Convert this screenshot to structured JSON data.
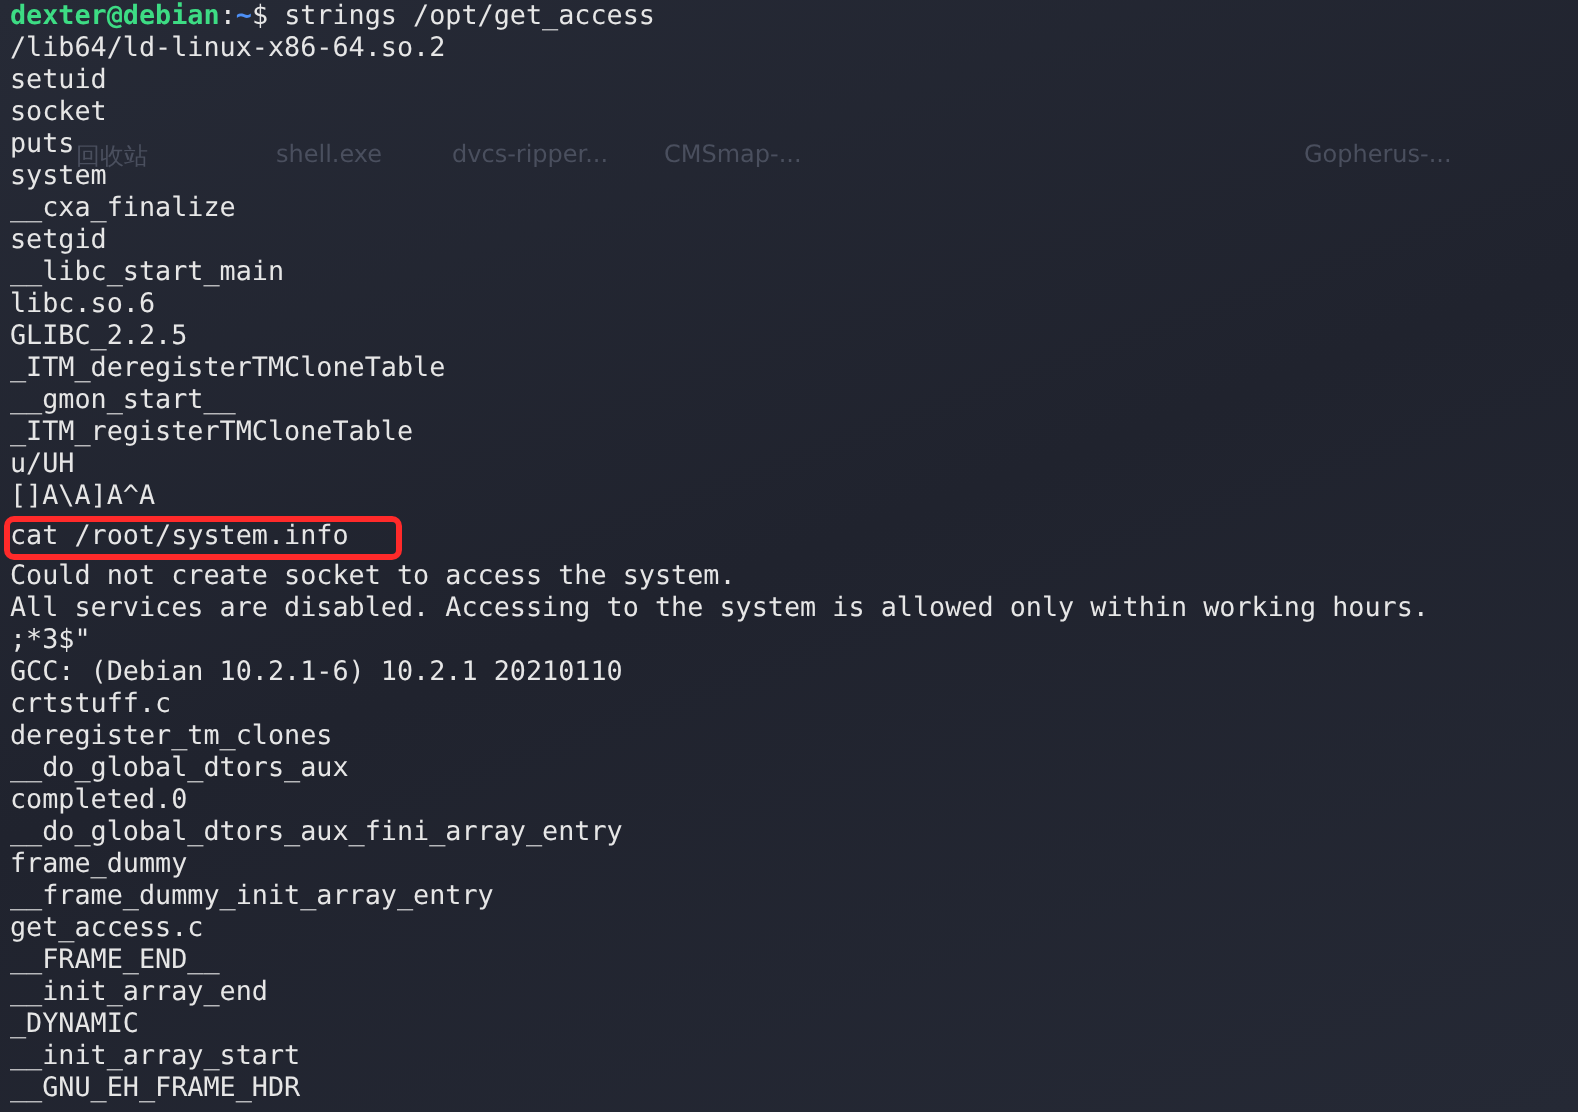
{
  "desktop_icons": [
    {
      "label": "回收站"
    },
    {
      "label": "shell.exe"
    },
    {
      "label": "dvcs-ripper..."
    },
    {
      "label": "CMSmap-..."
    },
    {
      "label": "Gopherus-..."
    }
  ],
  "terminal": {
    "prompt": {
      "user_host": "dexter@debian",
      "separator": ":",
      "path": "~",
      "symbol": "$",
      "command": "strings /opt/get_access"
    },
    "lines": [
      {
        "text": "/lib64/ld-linux-x86-64.so.2",
        "highlighted": false
      },
      {
        "text": "setuid",
        "highlighted": false
      },
      {
        "text": "socket",
        "highlighted": false
      },
      {
        "text": "puts",
        "highlighted": false
      },
      {
        "text": "system",
        "highlighted": false
      },
      {
        "text": "__cxa_finalize",
        "highlighted": false
      },
      {
        "text": "setgid",
        "highlighted": false
      },
      {
        "text": "__libc_start_main",
        "highlighted": false
      },
      {
        "text": "libc.so.6",
        "highlighted": false
      },
      {
        "text": "GLIBC_2.2.5",
        "highlighted": false
      },
      {
        "text": "_ITM_deregisterTMCloneTable",
        "highlighted": false
      },
      {
        "text": "__gmon_start__",
        "highlighted": false
      },
      {
        "text": "_ITM_registerTMCloneTable",
        "highlighted": false
      },
      {
        "text": "u/UH",
        "highlighted": false
      },
      {
        "text": "[]A\\A]A^A",
        "highlighted": false
      },
      {
        "text": "cat /root/system.info",
        "highlighted": true
      },
      {
        "text": "Could not create socket to access the system.",
        "highlighted": false
      },
      {
        "text": "All services are disabled. Accessing to the system is allowed only within working hours.",
        "highlighted": false
      },
      {
        "text": ";*3$\"",
        "highlighted": false
      },
      {
        "text": "GCC: (Debian 10.2.1-6) 10.2.1 20210110",
        "highlighted": false
      },
      {
        "text": "crtstuff.c",
        "highlighted": false
      },
      {
        "text": "deregister_tm_clones",
        "highlighted": false
      },
      {
        "text": "__do_global_dtors_aux",
        "highlighted": false
      },
      {
        "text": "completed.0",
        "highlighted": false
      },
      {
        "text": "__do_global_dtors_aux_fini_array_entry",
        "highlighted": false
      },
      {
        "text": "frame_dummy",
        "highlighted": false
      },
      {
        "text": "__frame_dummy_init_array_entry",
        "highlighted": false
      },
      {
        "text": "get_access.c",
        "highlighted": false
      },
      {
        "text": "__FRAME_END__",
        "highlighted": false
      },
      {
        "text": "__init_array_end",
        "highlighted": false
      },
      {
        "text": "_DYNAMIC",
        "highlighted": false
      },
      {
        "text": "__init_array_start",
        "highlighted": false
      },
      {
        "text": "__GNU_EH_FRAME_HDR",
        "highlighted": false
      }
    ]
  }
}
